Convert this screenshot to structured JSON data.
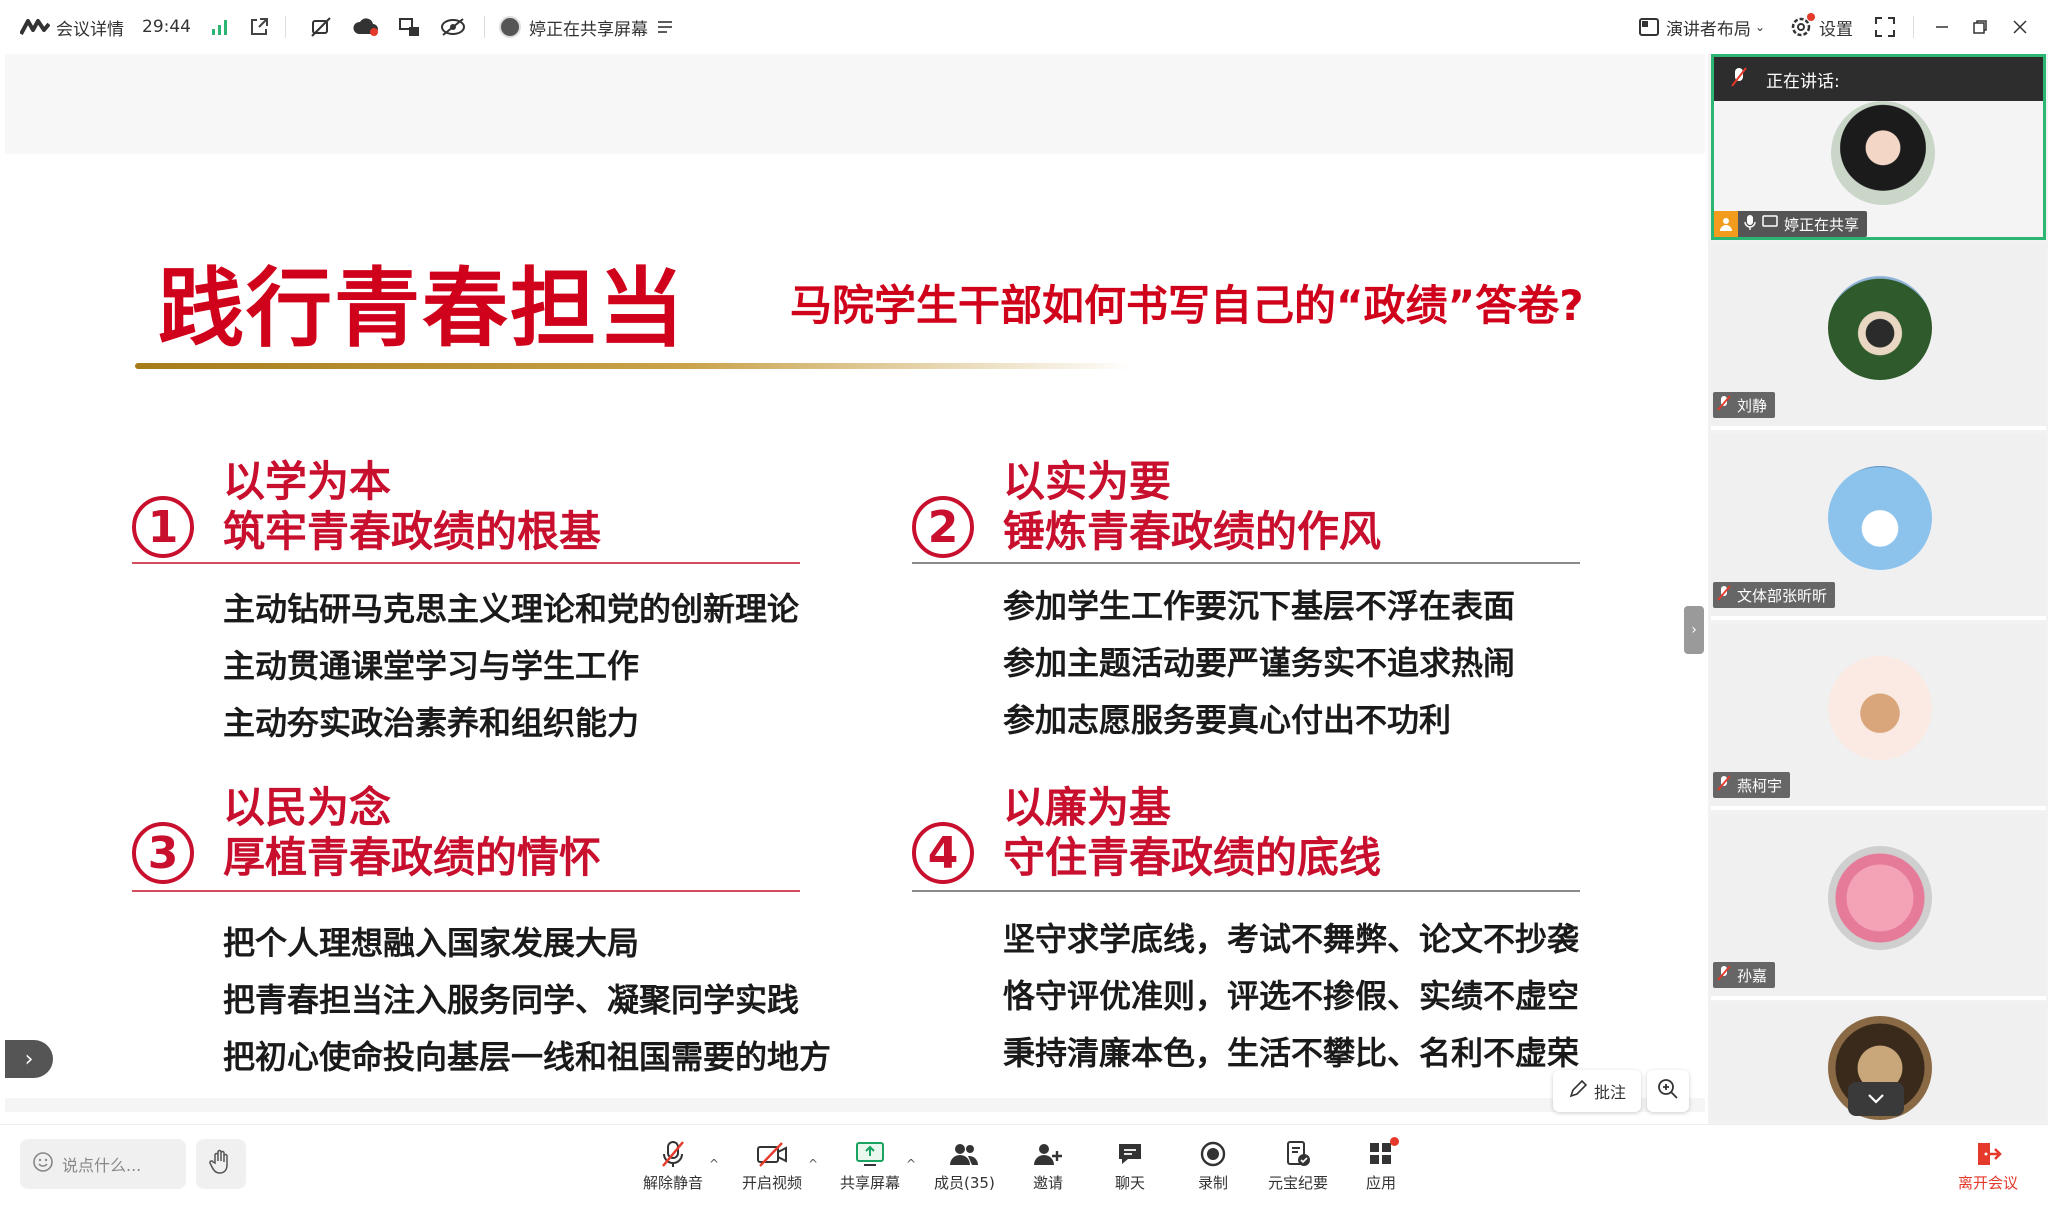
{
  "topbar": {
    "meeting_info": "会议详情",
    "timer": "29:44",
    "sharing_status": "婷正在共享屏幕",
    "layout_label": "演讲者布局",
    "settings_label": "设置"
  },
  "slide": {
    "title": "践行青春担当",
    "subtitle": "马院学生干部如何书写自己的“政绩”答卷?",
    "sections": [
      {
        "num": "1",
        "head1": "以学为本",
        "head2": "筑牢青春政绩的根基",
        "lines": [
          "主动钻研马克思主义理论和党的创新理论",
          "主动贯通课堂学习与学生工作",
          "主动夯实政治素养和组织能力"
        ]
      },
      {
        "num": "2",
        "head1": "以实为要",
        "head2": "锤炼青春政绩的作风",
        "lines": [
          "参加学生工作要沉下基层不浮在表面",
          "参加主题活动要严谨务实不追求热闹",
          "参加志愿服务要真心付出不功利"
        ]
      },
      {
        "num": "3",
        "head1": "以民为念",
        "head2": "厚植青春政绩的情怀",
        "lines": [
          "把个人理想融入国家发展大局",
          "把青春担当注入服务同学、凝聚同学实践",
          "把初心使命投向基层一线和祖国需要的地方"
        ]
      },
      {
        "num": "4",
        "head1": "以廉为基",
        "head2": "守住青春政绩的底线",
        "lines": [
          "坚守求学底线，考试不舞弊、论文不抄袭",
          "恪守评优准则，评选不掺假、实绩不虚空",
          "秉持清廉本色，生活不攀比、名利不虚荣"
        ]
      }
    ],
    "annotate_label": "批注"
  },
  "participants": {
    "speaking_label": "正在讲话:",
    "active_name": "婷正在共享",
    "tiles": [
      {
        "name": "刘静"
      },
      {
        "name": "文体部张昕昕"
      },
      {
        "name": "燕柯宇"
      },
      {
        "name": "孙嘉"
      }
    ]
  },
  "bottombar": {
    "chat_placeholder": "说点什么...",
    "tools": {
      "unmute": "解除静音",
      "video": "开启视频",
      "share": "共享屏幕",
      "members": "成员(35)",
      "invite": "邀请",
      "chat": "聊天",
      "record": "录制",
      "summary": "元宝纪要",
      "apps": "应用"
    },
    "leave": "离开会议"
  },
  "colors": {
    "accent_red": "#d0021b",
    "active_green": "#2bb673",
    "leave_red": "#e4392b"
  }
}
